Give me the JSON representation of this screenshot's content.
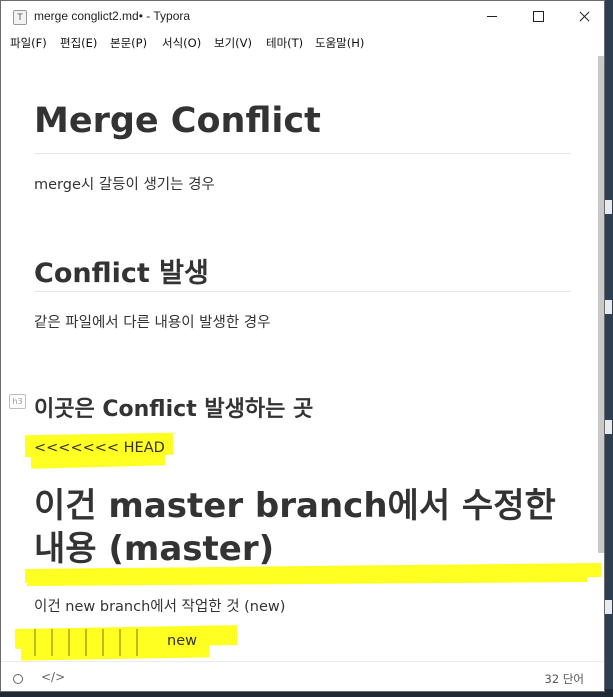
{
  "window": {
    "title": "merge conglict2.md• - Typora",
    "app_icon": "T"
  },
  "menu": [
    "파일(F)",
    "편집(E)",
    "본문(P)",
    "서식(O)",
    "보기(V)",
    "테마(T)",
    "도움말(H)"
  ],
  "document": {
    "h1": "Merge Conflict",
    "h1_para": "merge시 갈등이 생기는 경우",
    "h2": "Conflict 발생",
    "h2_para": "같은 파일에서 다른 내용이 발생한 경우",
    "h3_badge": "h3",
    "h3": "이곳은 Conflict 발생하는 곳",
    "head_marker": "<<<<<<< HEAD",
    "master_line1": "이건 master branch에서 수정한",
    "master_line2": "내용 (master)",
    "new_para": "이건 new branch에서 작업한 것 (new)",
    "new_marker": "new"
  },
  "status": {
    "code_icon": "</>",
    "word_count": "32 단어"
  },
  "colors": {
    "highlight": "#ffff22",
    "text": "#333333"
  }
}
